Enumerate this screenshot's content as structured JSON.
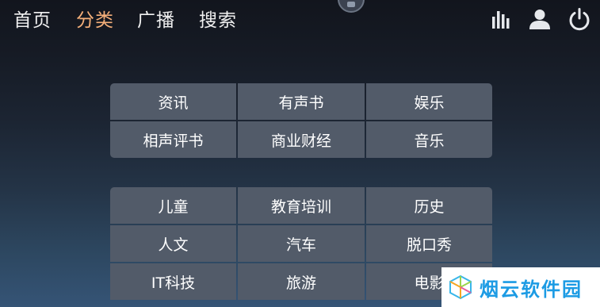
{
  "nav": {
    "tabs": [
      {
        "label": "首页"
      },
      {
        "label": "分类"
      },
      {
        "label": "广播"
      },
      {
        "label": "搜索"
      }
    ],
    "active_index": 1,
    "active_color": "#f6b07a",
    "icons": [
      "equalizer-icon",
      "user-icon",
      "power-icon"
    ]
  },
  "categories": {
    "group1": [
      "资讯",
      "有声书",
      "娱乐",
      "相声评书",
      "商业财经",
      "音乐"
    ],
    "group2": [
      "儿童",
      "教育培训",
      "历史",
      "人文",
      "汽车",
      "脱口秀",
      "IT科技",
      "旅游",
      "电影"
    ]
  },
  "colors": {
    "tile": "#525b69",
    "background_top": "#12151d",
    "background_bottom": "#355476",
    "watermark_text": "#1c9be4"
  },
  "watermark": {
    "text": "烟云软件园"
  }
}
